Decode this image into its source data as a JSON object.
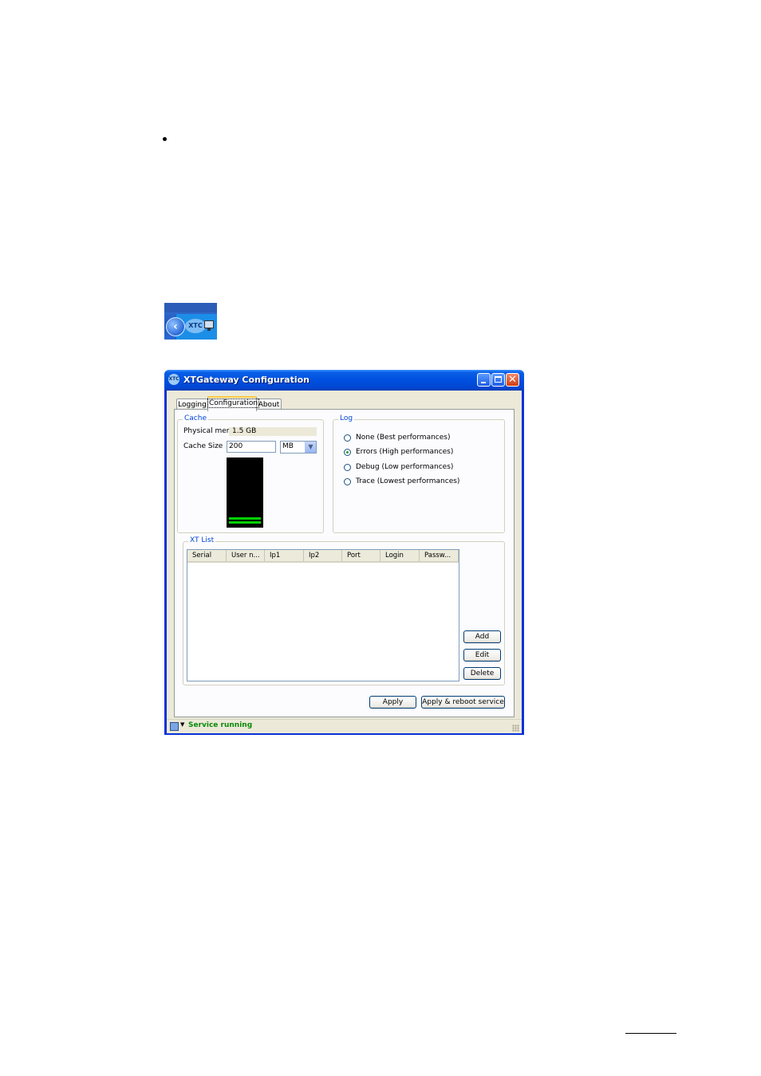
{
  "tray": {
    "logo_text": "XTC"
  },
  "window": {
    "title": "XTGateway Configuration",
    "icon_text": "XTC",
    "close_glyph": "✕",
    "tabs": [
      {
        "label": "Logging"
      },
      {
        "label": "Configuration"
      },
      {
        "label": "About"
      }
    ],
    "cache": {
      "legend": "Cache",
      "physical_memory_label": "Physical memory:",
      "physical_memory_value": "1.5 GB",
      "cache_size_label": "Cache Size",
      "cache_size_value": "200",
      "unit_selected": "MB"
    },
    "log": {
      "legend": "Log",
      "options": [
        {
          "label": "None (Best performances)",
          "checked": false
        },
        {
          "label": "Errors (High performances)",
          "checked": true
        },
        {
          "label": "Debug (Low performances)",
          "checked": false
        },
        {
          "label": "Trace (Lowest performances)",
          "checked": false
        }
      ]
    },
    "xt_list": {
      "legend": "XT List",
      "columns": [
        "Serial",
        "User n...",
        "Ip1",
        "Ip2",
        "Port",
        "Login",
        "Passw..."
      ],
      "rows": [],
      "add_label": "Add",
      "edit_label": "Edit",
      "delete_label": "Delete"
    },
    "apply_label": "Apply",
    "apply_reboot_label": "Apply & reboot service",
    "status": {
      "text": "Service running",
      "color": "#0a8a0a"
    }
  }
}
